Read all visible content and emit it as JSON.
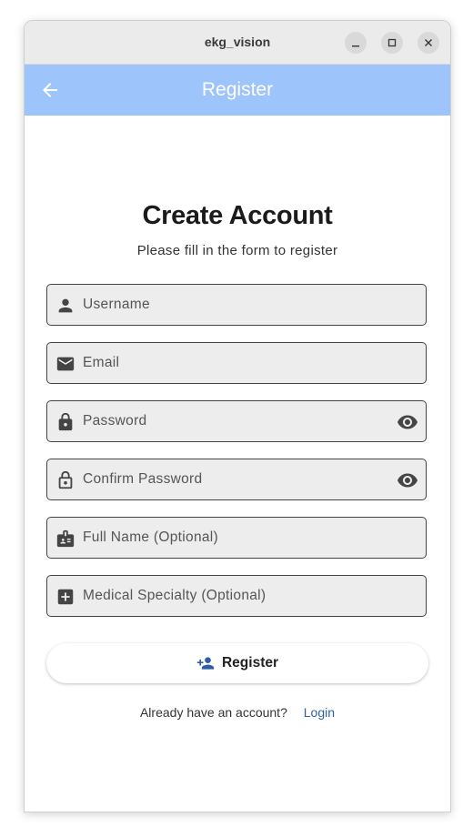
{
  "window": {
    "title": "ekg_vision"
  },
  "appbar": {
    "title": "Register"
  },
  "heading": "Create Account",
  "subtitle": "Please fill in the form to register",
  "fields": [
    {
      "placeholder": "Username",
      "icon": "person-icon"
    },
    {
      "placeholder": "Email",
      "icon": "email-icon"
    },
    {
      "placeholder": "Password",
      "icon": "lock-icon",
      "toggle": "visibility-icon"
    },
    {
      "placeholder": "Confirm Password",
      "icon": "lock-outline-icon",
      "toggle": "visibility-icon"
    },
    {
      "placeholder": "Full Name (Optional)",
      "icon": "badge-icon"
    },
    {
      "placeholder": "Medical Specialty (Optional)",
      "icon": "medical-cross-icon"
    }
  ],
  "register_button": {
    "label": "Register",
    "icon": "person-add-icon"
  },
  "login_prompt": {
    "text": "Already have an account?",
    "link": "Login"
  },
  "colors": {
    "appbar": "#9dc4fb",
    "link": "#2e5da8",
    "field_bg": "#ededed"
  }
}
